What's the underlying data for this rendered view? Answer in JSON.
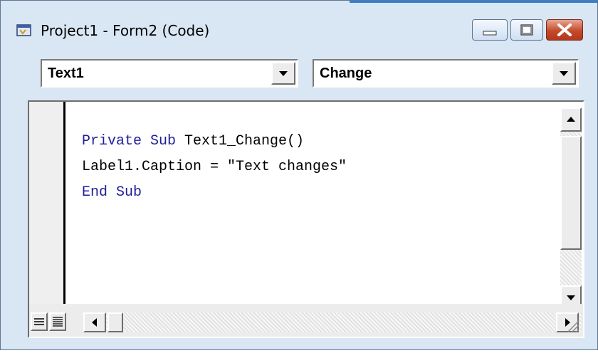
{
  "window": {
    "title": "Project1 - Form2 (Code)"
  },
  "object_dropdown": {
    "selected": "Text1"
  },
  "procedure_dropdown": {
    "selected": "Change"
  },
  "code_lines": [
    {
      "keyword1": "Private Sub",
      "rest": " Text1_Change()"
    },
    {
      "text": "Label1.Caption = \"Text changes\""
    },
    {
      "keyword1": "End Sub",
      "rest": ""
    }
  ],
  "icons": {
    "app": "vb-form-icon",
    "minimize": "minimize-icon",
    "maximize": "maximize-icon",
    "close": "close-icon",
    "dropdown": "chevron-down-icon",
    "procedure_view": "procedure-view-icon",
    "full_module_view": "full-module-view-icon"
  },
  "colors": {
    "keyword": "#1e1e9c",
    "close_button": "#c54a2a",
    "title_accent": "#2f7fd6"
  }
}
